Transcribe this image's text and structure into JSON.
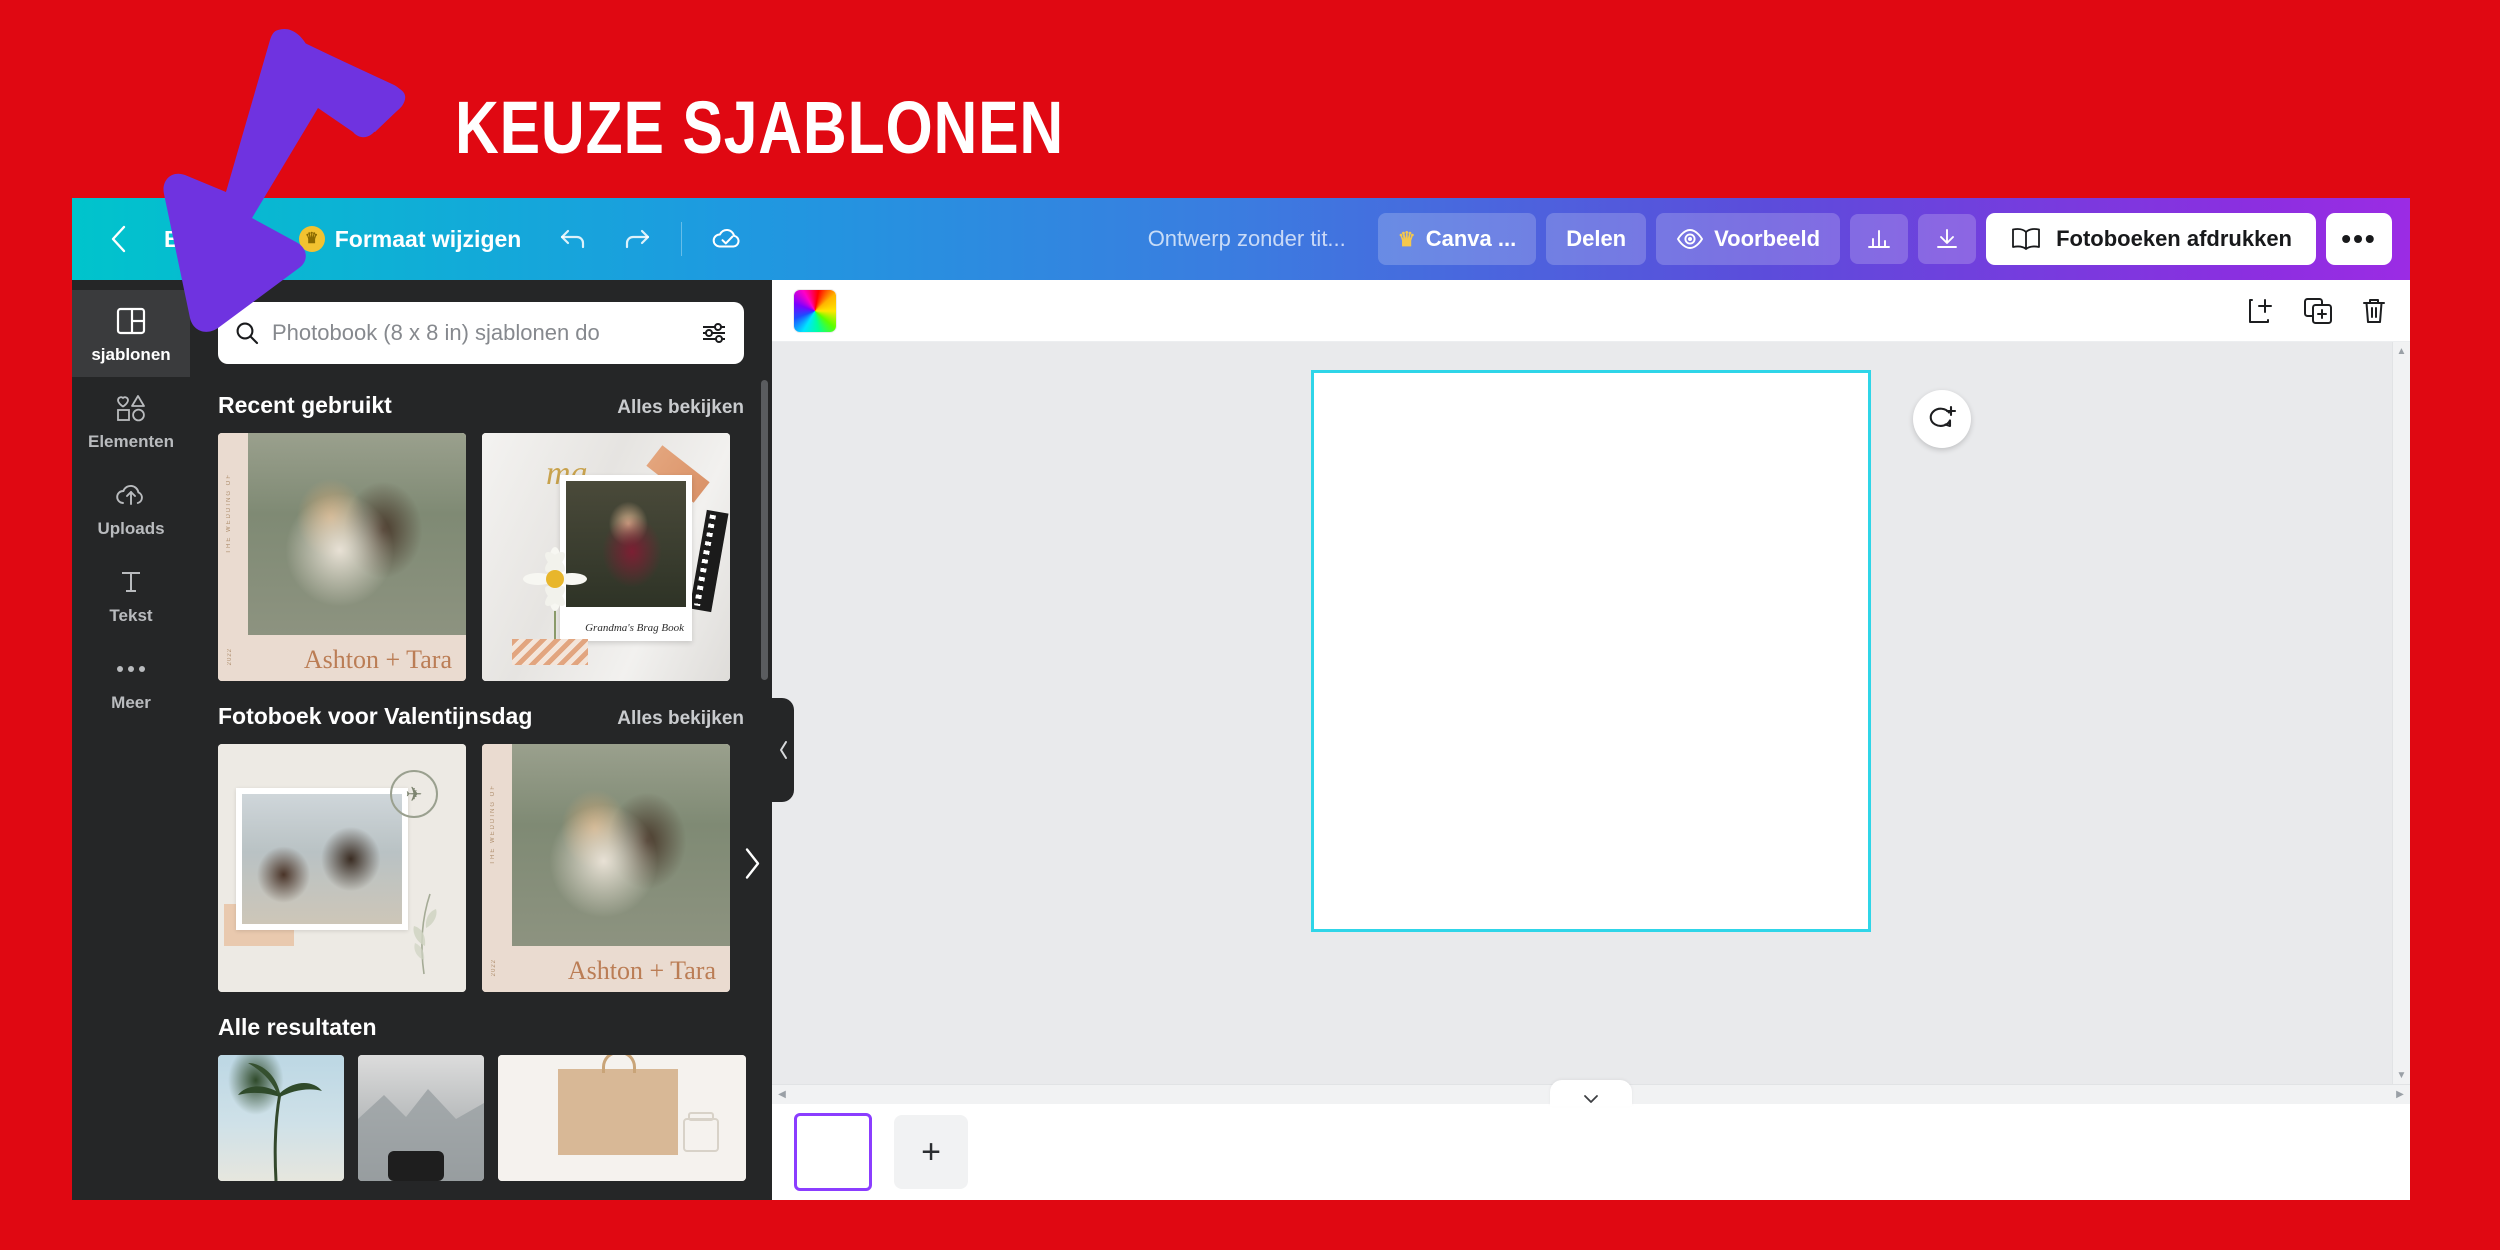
{
  "banner": {
    "title": "KEUZE SJABLONEN",
    "bg_color": "#e00812",
    "arrow_color": "#6f33e0"
  },
  "toolbar": {
    "back_icon": "chevron-left-icon",
    "file_label": "Bestand",
    "resize_label": "Formaat wijzigen",
    "resize_badge_icon": "crown-icon",
    "undo_icon": "undo-icon",
    "redo_icon": "redo-icon",
    "cloud_icon": "cloud-check-icon",
    "doc_title": "Ontwerp zonder tit...",
    "canva_pro_label": "Canva ...",
    "canva_pro_icon": "crown-icon",
    "share_label": "Delen",
    "preview_label": "Voorbeeld",
    "preview_icon": "eye-icon",
    "stats_icon": "bar-chart-icon",
    "download_icon": "download-icon",
    "print_label": "Fotoboeken afdrukken",
    "print_icon": "open-book-icon",
    "more_label": "•••"
  },
  "sidebar": {
    "items": [
      {
        "label": "sjablonen",
        "icon": "layout-grid-icon",
        "active": true
      },
      {
        "label": "Elementen",
        "icon": "shapes-icon",
        "active": false
      },
      {
        "label": "Uploads",
        "icon": "cloud-upload-icon",
        "active": false
      },
      {
        "label": "Tekst",
        "icon": "text-T-icon",
        "active": false
      },
      {
        "label": "Meer",
        "icon": "ellipsis-icon",
        "active": false
      }
    ]
  },
  "panel": {
    "search": {
      "placeholder": "Photobook (8 x 8 in) sjablonen do",
      "value": "",
      "search_icon": "search-icon",
      "filter_icon": "sliders-icon"
    },
    "collapse_icon": "chevron-left-icon",
    "sections": [
      {
        "title": "Recent gebruikt",
        "link": "Alles bekijken",
        "next_icon": "chevron-right-icon",
        "thumbs": [
          {
            "name": "wedding-ashton-tara-template",
            "caption": "Ashton + Tara",
            "vtext": "THE WEDDING OF",
            "vdate": "2022",
            "art": "wed"
          },
          {
            "name": "grandmas-brag-book-template",
            "caption": "Grandma's Brag Book",
            "script": "ma",
            "art": "grandma"
          }
        ]
      },
      {
        "title": "Fotoboek voor Valentijnsdag",
        "link": "Alles bekijken",
        "next_icon": "chevron-right-icon",
        "thumbs": [
          {
            "name": "family-travel-template",
            "caption": "",
            "art": "fam"
          },
          {
            "name": "wedding-ashton-tara-template-2",
            "caption": "Ashton + Tara",
            "vtext": "THE WEDDING OF",
            "vdate": "2022",
            "art": "wed"
          }
        ]
      },
      {
        "title": "Alle resultaten",
        "link": "",
        "next_icon": "",
        "thumbs": [
          {
            "name": "palm-beach-template",
            "caption": "",
            "art": "palm"
          },
          {
            "name": "grayscale-mountain-template",
            "caption": "",
            "art": "gray"
          },
          {
            "name": "paper-bag-template",
            "caption": "",
            "art": "bag"
          }
        ]
      }
    ]
  },
  "canvas": {
    "color_swatch_name": "color-picker-swatch",
    "add_page_icon": "add-page-icon",
    "duplicate_page_icon": "duplicate-page-icon",
    "delete_page_icon": "trash-icon",
    "comment_icon": "add-comment-icon",
    "page_border_color": "#2fd5e8",
    "expand_icon": "chevron-down-icon",
    "scroll_left_icon": "chevron-left-icon",
    "scroll_right_icon": "chevron-right-icon",
    "scroll_up_icon": "chevron-up-icon",
    "scroll_down_icon": "chevron-down-icon"
  },
  "pagebar": {
    "page_thumb_name": "page-thumbnail-1",
    "add_page_label": "+"
  }
}
